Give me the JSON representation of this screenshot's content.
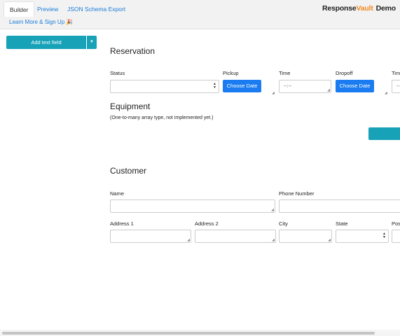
{
  "tabs": [
    {
      "label": "Builder",
      "active": true
    },
    {
      "label": "Preview",
      "active": false
    },
    {
      "label": "JSON Schema Export",
      "active": false
    }
  ],
  "learn_more": "Learn More & Sign Up 🎉",
  "brand": {
    "part1": "Response",
    "part2": "Vault",
    "demo": "Demo",
    "accent": "#f08a24"
  },
  "add_button": {
    "label": "Add text field",
    "caret": "▼"
  },
  "reservation": {
    "title": "Reservation",
    "status_label": "Status",
    "pickup_label": "Pickup",
    "pickup_button": "Choose Date",
    "time_label": "Time",
    "time_placeholder": "--:--",
    "dropoff_label": "Dropoff",
    "dropoff_button": "Choose Date",
    "time2_label": "Tim",
    "time2_placeholder": "--"
  },
  "equipment": {
    "title": "Equipment",
    "note": "(One-to-many array type, not implemented yet.)"
  },
  "customer": {
    "title": "Customer",
    "name_label": "Name",
    "phone_label": "Phone Number",
    "address1_label": "Address 1",
    "address2_label": "Address 2",
    "city_label": "City",
    "state_label": "State",
    "postal_label": "Pos"
  },
  "colors": {
    "teal": "#17a2b8",
    "blue": "#1a7cf0",
    "link": "#1a7cd9"
  }
}
